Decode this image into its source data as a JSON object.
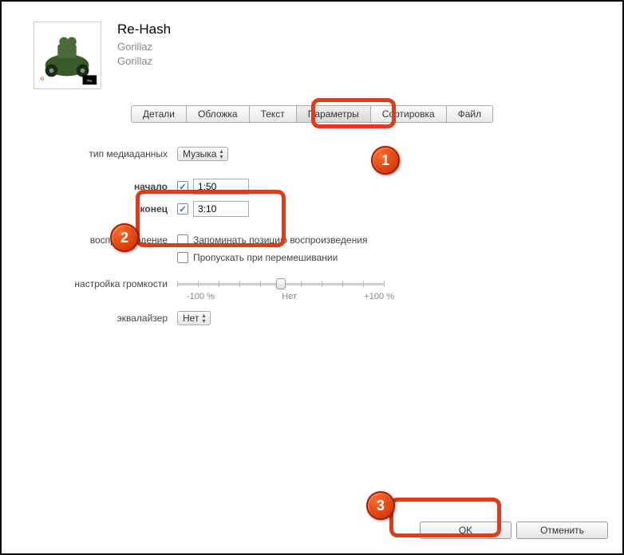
{
  "header": {
    "title": "Re-Hash",
    "artist": "Gorillaz",
    "album": "Gorillaz"
  },
  "tabs": {
    "details": "Детали",
    "artwork": "Обложка",
    "lyrics": "Текст",
    "options": "Параметры",
    "sorting": "Сортировка",
    "file": "Файл"
  },
  "form": {
    "media_type_label": "тип медиаданных",
    "media_type_value": "Музыка",
    "start_label": "начало",
    "start_value": "1:50",
    "end_label": "конец",
    "end_value": "3:10",
    "playback_label": "воспроизведение",
    "remember_position": "Запоминать позицию воспроизведения",
    "skip_shuffle": "Пропускать при перемешивании",
    "volume_label": "настройка громкости",
    "volume_min": "-100 %",
    "volume_mid": "Нет",
    "volume_max": "+100 %",
    "equalizer_label": "эквалайзер",
    "equalizer_value": "Нет"
  },
  "buttons": {
    "ok": "OK",
    "cancel": "Отменить"
  },
  "badges": {
    "b1": "1",
    "b2": "2",
    "b3": "3"
  }
}
